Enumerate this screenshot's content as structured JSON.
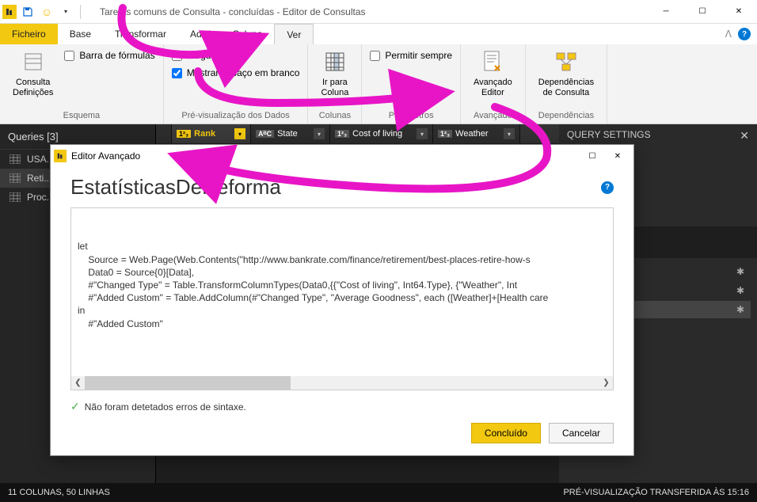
{
  "window": {
    "title": "Tarefas comuns de Consulta - concluídas - Editor de Consultas"
  },
  "menuTabs": {
    "file": "Ficheiro",
    "home": "Base",
    "transform": "Transformar",
    "addColumn": "Adicionar Coluna",
    "view": "Ver"
  },
  "ribbon": {
    "querySettings": "Consulta\nDefinições",
    "formulaBar": "Barra de fórmulas",
    "layoutGroup": "Esquema",
    "fixedWidth": "Largura fixa",
    "showWhitespace": "Mostrar espaço em branco",
    "dataPreviewGroup": "Pré-visualização dos Dados",
    "goToColumn": "Ir para\nColuna",
    "columnsGroup": "Colunas",
    "alwaysAllow": "Permitir sempre",
    "parametersGroup": "Parâmetros",
    "advancedEditor": "Avançado\nEditor",
    "advancedGroup": "Avançado",
    "queryDeps": "Dependências\nde Consulta",
    "depsGroup": "Dependências"
  },
  "queries": {
    "header": "Queries [3]",
    "items": [
      {
        "name": "USA..."
      },
      {
        "name": "Reti..."
      },
      {
        "name": "Proc..."
      }
    ]
  },
  "columns": [
    {
      "typeBadge": "1²₃",
      "name": "Rank"
    },
    {
      "typeBadge": "AᴮC",
      "name": "State"
    },
    {
      "typeBadge": "1²₃",
      "name": "Cost of living"
    },
    {
      "typeBadge": "1²₃",
      "name": "Weather"
    }
  ],
  "settings": {
    "header": "QUERY SETTINGS"
  },
  "statusbar": {
    "left": "11 COLUNAS, 50 LINHAS",
    "right": "PRÉ-VISUALIZAÇÃO TRANSFERIDA ÀS 15:16"
  },
  "dialog": {
    "title": "Editor Avançado",
    "heading": "EstatísticasDeReforma",
    "code": "let\n    Source = Web.Page(Web.Contents(\"http://www.bankrate.com/finance/retirement/best-places-retire-how-s\n    Data0 = Source{0}[Data],\n    #\"Changed Type\" = Table.TransformColumnTypes(Data0,{{\"Cost of living\", Int64.Type}, {\"Weather\", Int\n    #\"Added Custom\" = Table.AddColumn(#\"Changed Type\", \"Average Goodness\", each ([Weather]+[Health care\nin\n    #\"Added Custom\"",
    "syntaxOk": "Não foram detetados erros de sintaxe.",
    "done": "Concluído",
    "cancel": "Cancelar"
  }
}
